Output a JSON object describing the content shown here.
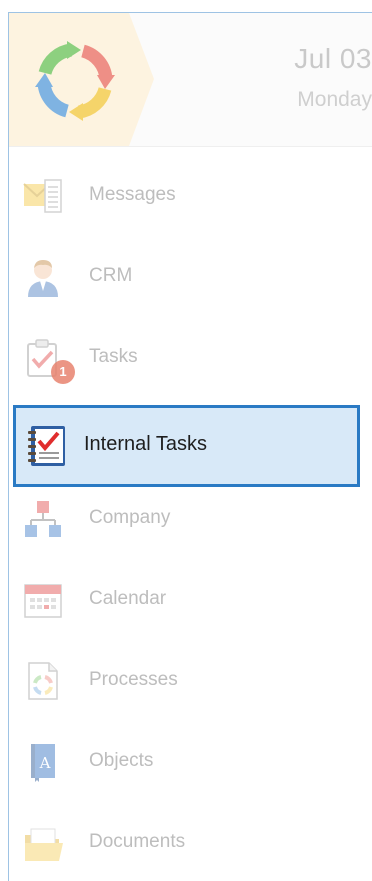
{
  "header": {
    "date": "Jul 03",
    "weekday": "Monday",
    "logo_icon": "circular-arrows-logo-icon"
  },
  "menu": {
    "items": [
      {
        "label": "Messages",
        "icon": "envelope-icon"
      },
      {
        "label": "CRM",
        "icon": "person-icon"
      },
      {
        "label": "Tasks",
        "icon": "clipboard-check-icon",
        "badge": "1"
      },
      {
        "label": "Internal Tasks",
        "icon": "notebook-checklist-icon",
        "active": true
      },
      {
        "label": "Company",
        "icon": "org-chart-icon"
      },
      {
        "label": "Calendar",
        "icon": "calendar-icon"
      },
      {
        "label": "Processes",
        "icon": "process-document-icon"
      },
      {
        "label": "Objects",
        "icon": "book-icon"
      },
      {
        "label": "Documents",
        "icon": "folder-icon"
      }
    ]
  },
  "colors": {
    "accent": "#2a7ac4",
    "active_background": "#d8e9f8",
    "badge": "#e8836f"
  }
}
